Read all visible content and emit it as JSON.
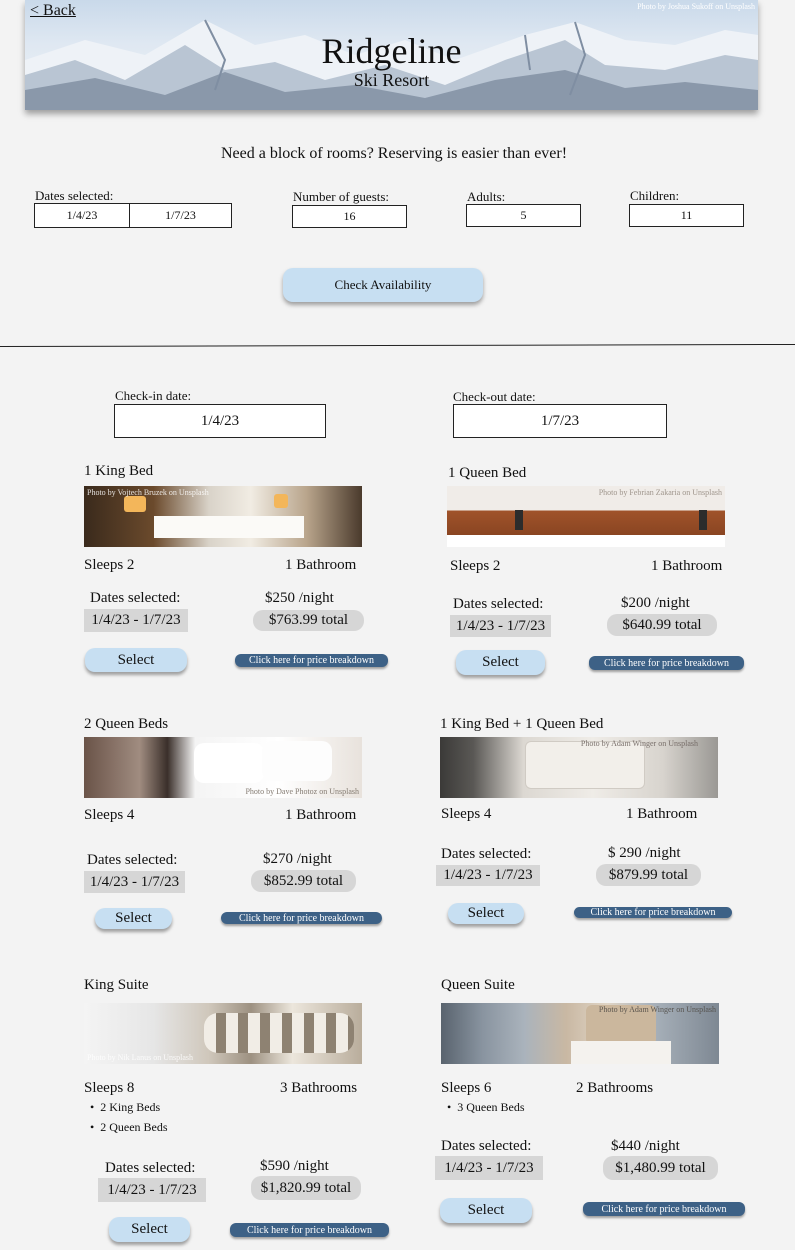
{
  "header": {
    "back": "< Back",
    "photo_credit": "Photo by Joshua Sukoff on Unsplash",
    "title": "Ridgeline",
    "subtitle": "Ski Resort"
  },
  "search": {
    "tagline": "Need a block of rooms? Reserving is easier than ever!",
    "dates_label": "Dates selected:",
    "date_start": "1/4/23",
    "date_end": "1/7/23",
    "guests_label": "Number of guests:",
    "guests": "16",
    "adults_label": "Adults:",
    "adults": "5",
    "children_label": "Children:",
    "children": "11",
    "check_button": "Check Availability"
  },
  "stay": {
    "checkin_label": "Check-in date:",
    "checkin": "1/4/23",
    "checkout_label": "Check-out date:",
    "checkout": "1/7/23"
  },
  "common": {
    "dates_label": "Dates selected:",
    "select": "Select",
    "breakdown": "Click here for price breakdown"
  },
  "rooms": [
    {
      "title": "1 King Bed",
      "credit": "Photo by Vojtech Bruzek on Unsplash",
      "sleeps": "Sleeps 2",
      "baths": "1 Bathroom",
      "dates": "1/4/23 - 1/7/23",
      "night": "$250 /night",
      "total": "$763.99 total"
    },
    {
      "title": "1 Queen Bed",
      "credit": "Photo by Febrian Zakaria on Unsplash",
      "sleeps": "Sleeps 2",
      "baths": "1 Bathroom",
      "dates": "1/4/23 - 1/7/23",
      "night": "$200 /night",
      "total": "$640.99 total"
    },
    {
      "title": "2 Queen Beds",
      "credit": "Photo by Dave Photoz on Unsplash",
      "sleeps": "Sleeps 4",
      "baths": "1 Bathroom",
      "dates": "1/4/23 - 1/7/23",
      "night": "$270 /night",
      "total": "$852.99 total"
    },
    {
      "title": "1 King Bed + 1 Queen Bed",
      "credit": "Photo by Adam Winger on Unsplash",
      "sleeps": "Sleeps 4",
      "baths": "1 Bathroom",
      "dates": "1/4/23 - 1/7/23",
      "night": "$ 290 /night",
      "total": "$879.99 total"
    },
    {
      "title": "King Suite",
      "credit": "Photo by Nik Lanus on Unsplash",
      "sleeps": "Sleeps 8",
      "baths": "3 Bathrooms",
      "features": [
        "2 King Beds",
        "2 Queen Beds"
      ],
      "dates": "1/4/23 - 1/7/23",
      "night": "$590 /night",
      "total": "$1,820.99 total"
    },
    {
      "title": "Queen Suite",
      "credit": "Photo by Adam Winger on Unsplash",
      "sleeps": "Sleeps 6",
      "baths": "2 Bathrooms",
      "features": [
        "3 Queen Beds"
      ],
      "dates": "1/4/23 - 1/7/23",
      "night": "$440 /night",
      "total": "$1,480.99 total"
    }
  ]
}
